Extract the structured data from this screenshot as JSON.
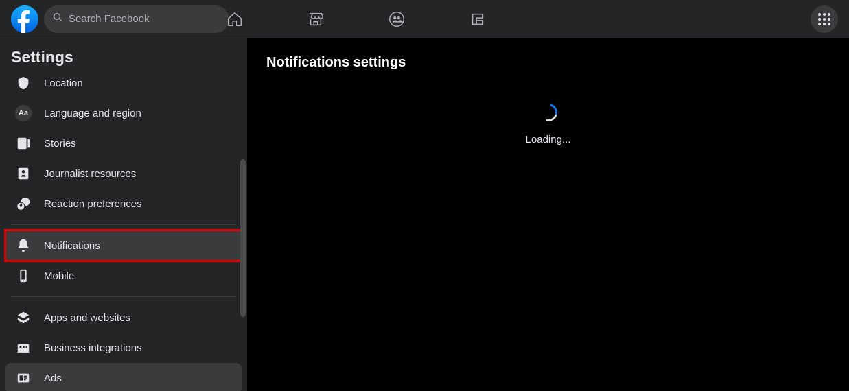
{
  "header": {
    "search_placeholder": "Search Facebook"
  },
  "sidebar": {
    "title": "Settings",
    "items": [
      {
        "label": "Location"
      },
      {
        "label": "Language and region"
      },
      {
        "label": "Stories"
      },
      {
        "label": "Journalist resources"
      },
      {
        "label": "Reaction preferences"
      },
      {
        "label": "Notifications"
      },
      {
        "label": "Mobile"
      },
      {
        "label": "Apps and websites"
      },
      {
        "label": "Business integrations"
      },
      {
        "label": "Ads"
      }
    ]
  },
  "content": {
    "title": "Notifications settings",
    "loading_text": "Loading..."
  }
}
